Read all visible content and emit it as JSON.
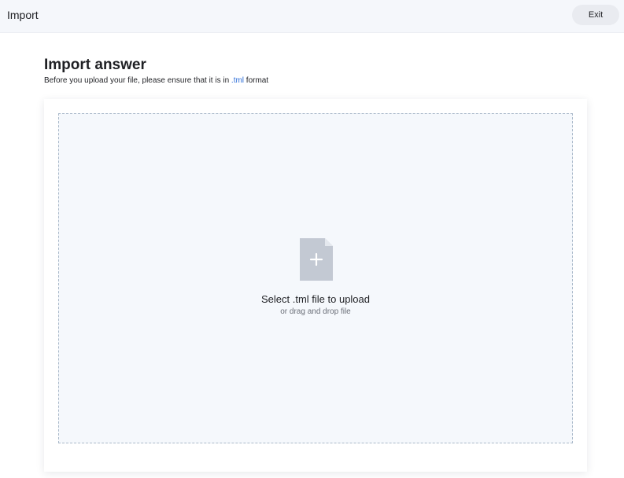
{
  "header": {
    "title": "Import",
    "exit_label": "Exit"
  },
  "main": {
    "title": "Import answer",
    "subtitle_before": "Before you upload your file, please ensure that it is in ",
    "subtitle_link": ".tml",
    "subtitle_after": " format"
  },
  "upload": {
    "icon": "file-plus-icon",
    "title": "Select .tml file to upload",
    "subtitle": "or drag and drop file"
  },
  "colors": {
    "accent": "#2f6fd8",
    "dropzone_bg": "#f5f8fc",
    "dropzone_border": "#a9b8c9",
    "icon_fill": "#c3c9d3"
  }
}
